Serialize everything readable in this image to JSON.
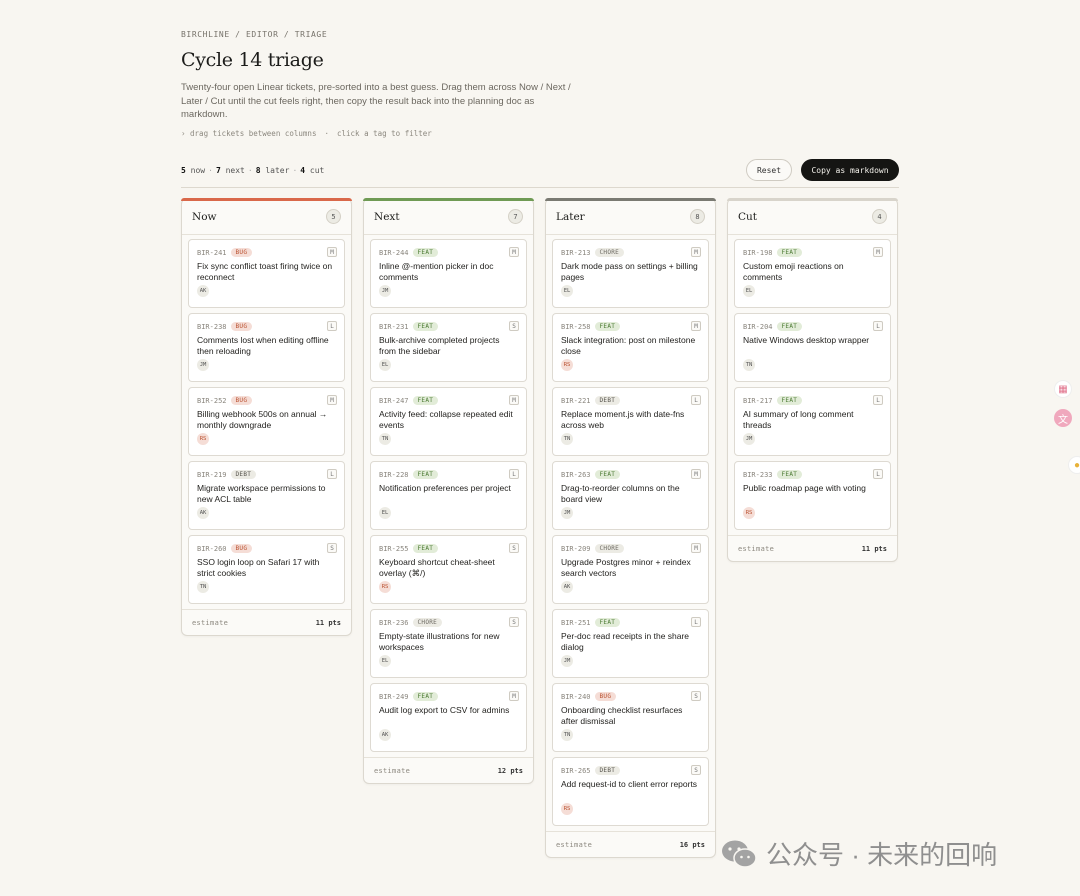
{
  "breadcrumb": "BIRCHLINE / EDITOR / TRIAGE",
  "title": "Cycle 14 triage",
  "description": "Twenty-four open Linear tickets, pre-sorted into a best guess. Drag them across Now / Next / Later / Cut until the cut feels right, then copy the result back into the planning doc as markdown.",
  "hint_drag": "› drag tickets between columns",
  "hint_sep": "·",
  "hint_filter": "click a tag to filter",
  "summary": {
    "now_count": "5",
    "now_label": "now",
    "next_count": "7",
    "next_label": "next",
    "later_count": "8",
    "later_label": "later",
    "cut_count": "4",
    "cut_label": "cut",
    "sep": "·"
  },
  "buttons": {
    "reset": "Reset",
    "copy": "Copy as markdown"
  },
  "colors": {
    "now": "#d9684a",
    "next": "#6f9a54",
    "later": "#7a7a72",
    "cut": "#d8d4cb"
  },
  "columns": [
    {
      "title": "Now",
      "count": "5",
      "estimate_label": "estimate",
      "estimate": "11 pts",
      "cards": [
        {
          "id": "BIR-241",
          "tag": "BUG",
          "size": "M",
          "title": "Fix sync conflict toast firing twice on reconnect",
          "assignee": "AK"
        },
        {
          "id": "BIR-238",
          "tag": "BUG",
          "size": "L",
          "title": "Comments lost when editing offline then reloading",
          "assignee": "JM"
        },
        {
          "id": "BIR-252",
          "tag": "BUG",
          "size": "M",
          "title": "Billing webhook 500s on annual → monthly downgrade",
          "assignee": "RS"
        },
        {
          "id": "BIR-219",
          "tag": "DEBT",
          "size": "L",
          "title": "Migrate workspace permissions to new ACL table",
          "assignee": "AK"
        },
        {
          "id": "BIR-260",
          "tag": "BUG",
          "size": "S",
          "title": "SSO login loop on Safari 17 with strict cookies",
          "assignee": "TN"
        }
      ]
    },
    {
      "title": "Next",
      "count": "7",
      "estimate_label": "estimate",
      "estimate": "12 pts",
      "cards": [
        {
          "id": "BIR-244",
          "tag": "FEAT",
          "size": "M",
          "title": "Inline @-mention picker in doc comments",
          "assignee": "JM"
        },
        {
          "id": "BIR-231",
          "tag": "FEAT",
          "size": "S",
          "title": "Bulk-archive completed projects from the sidebar",
          "assignee": "EL"
        },
        {
          "id": "BIR-247",
          "tag": "FEAT",
          "size": "M",
          "title": "Activity feed: collapse repeated edit events",
          "assignee": "TN"
        },
        {
          "id": "BIR-228",
          "tag": "FEAT",
          "size": "L",
          "title": "Notification preferences per project",
          "assignee": "EL"
        },
        {
          "id": "BIR-255",
          "tag": "FEAT",
          "size": "S",
          "title": "Keyboard shortcut cheat-sheet overlay (⌘/)",
          "assignee": "RS"
        },
        {
          "id": "BIR-236",
          "tag": "CHORE",
          "size": "S",
          "title": "Empty-state illustrations for new workspaces",
          "assignee": "EL"
        },
        {
          "id": "BIR-249",
          "tag": "FEAT",
          "size": "M",
          "title": "Audit log export to CSV for admins",
          "assignee": "AK"
        }
      ]
    },
    {
      "title": "Later",
      "count": "8",
      "estimate_label": "estimate",
      "estimate": "16 pts",
      "cards": [
        {
          "id": "BIR-213",
          "tag": "CHORE",
          "size": "M",
          "title": "Dark mode pass on settings + billing pages",
          "assignee": "EL"
        },
        {
          "id": "BIR-258",
          "tag": "FEAT",
          "size": "M",
          "title": "Slack integration: post on milestone close",
          "assignee": "RS"
        },
        {
          "id": "BIR-221",
          "tag": "DEBT",
          "size": "L",
          "title": "Replace moment.js with date-fns across web",
          "assignee": "TN"
        },
        {
          "id": "BIR-263",
          "tag": "FEAT",
          "size": "M",
          "title": "Drag-to-reorder columns on the board view",
          "assignee": "JM"
        },
        {
          "id": "BIR-209",
          "tag": "CHORE",
          "size": "M",
          "title": "Upgrade Postgres minor + reindex search vectors",
          "assignee": "AK"
        },
        {
          "id": "BIR-251",
          "tag": "FEAT",
          "size": "L",
          "title": "Per-doc read receipts in the share dialog",
          "assignee": "JM"
        },
        {
          "id": "BIR-240",
          "tag": "BUG",
          "size": "S",
          "title": "Onboarding checklist resurfaces after dismissal",
          "assignee": "TN"
        },
        {
          "id": "BIR-265",
          "tag": "DEBT",
          "size": "S",
          "title": "Add request-id to client error reports",
          "assignee": "RS"
        }
      ]
    },
    {
      "title": "Cut",
      "count": "4",
      "estimate_label": "estimate",
      "estimate": "11 pts",
      "cards": [
        {
          "id": "BIR-198",
          "tag": "FEAT",
          "size": "M",
          "title": "Custom emoji reactions on comments",
          "assignee": "EL"
        },
        {
          "id": "BIR-204",
          "tag": "FEAT",
          "size": "L",
          "title": "Native Windows desktop wrapper",
          "assignee": "TN"
        },
        {
          "id": "BIR-217",
          "tag": "FEAT",
          "size": "L",
          "title": "AI summary of long comment threads",
          "assignee": "JM"
        },
        {
          "id": "BIR-233",
          "tag": "FEAT",
          "size": "L",
          "title": "Public roadmap page with voting",
          "assignee": "RS"
        }
      ]
    }
  ],
  "watermark": "公众号 · 未来的回响"
}
